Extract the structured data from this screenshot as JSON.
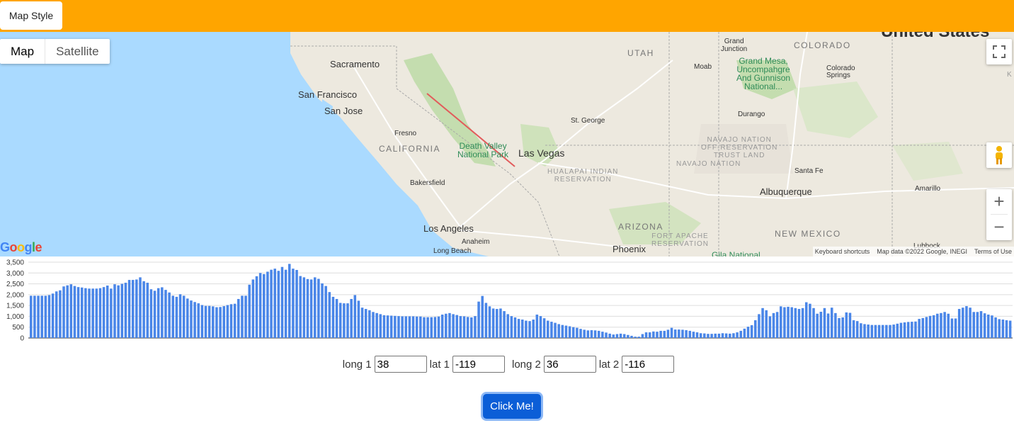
{
  "topbar": {
    "style_button": "Map Style",
    "color": "#FFA500"
  },
  "map": {
    "type_map": "Map",
    "type_satellite": "Satellite",
    "fullscreen_icon": "fullscreen-icon",
    "pegman_icon": "pegman-icon",
    "zoom_in": "+",
    "zoom_out": "−",
    "google_logo": "Google",
    "attribution": {
      "shortcuts": "Keyboard shortcuts",
      "data": "Map data ©2022 Google, INEGI",
      "terms": "Terms of Use"
    },
    "labels": {
      "sacramento": "Sacramento",
      "san_francisco": "San Francisco",
      "san_jose": "San Jose",
      "fresno": "Fresno",
      "california": "CALIFORNIA",
      "bakersfield": "Bakersfield",
      "los_angeles": "Los Angeles",
      "anaheim": "Anaheim",
      "long_beach": "Long Beach",
      "death_valley_1": "Death Valley",
      "death_valley_2": "National Park",
      "las_vegas": "Las Vegas",
      "st_george": "St. George",
      "hualapai_1": "HUALAPAI INDIAN",
      "hualapai_2": "RESERVATION",
      "utah": "UTAH",
      "grand_junction_1": "Grand",
      "grand_junction_2": "Junction",
      "colorado": "COLORADO",
      "moab": "Moab",
      "grand_mesa_1": "Grand Mesa,",
      "grand_mesa_2": "Uncompahgre",
      "grand_mesa_3": "And Gunnison",
      "grand_mesa_4": "National...",
      "colorado_springs_1": "Colorado",
      "colorado_springs_2": "Springs",
      "durango": "Durango",
      "navajo_1": "NAVAJO NATION",
      "navajo_2": "OFF-RESERVATION",
      "navajo_3": "TRUST LAND",
      "navajo_4": "NAVAJO NATION",
      "santa_fe": "Santa Fe",
      "albuquerque": "Albuquerque",
      "amarillo": "Amarillo",
      "united_states": "United States",
      "arizona": "ARIZONA",
      "fort_apache_1": "FORT APACHE",
      "fort_apache_2": "RESERVATION",
      "new_mexico": "NEW MEXICO",
      "phoenix": "Phoenix",
      "gila": "Gila National",
      "lubbock": "Lubbock",
      "k": "K"
    }
  },
  "chart_data": {
    "type": "bar",
    "yticks": [
      "3,500",
      "3,000",
      "2,500",
      "2,000",
      "1,500",
      "1,000",
      "500",
      "0"
    ],
    "ylim": [
      0,
      3500
    ],
    "grid": true,
    "color": "#4a86e8",
    "values": [
      1950,
      1950,
      1950,
      1950,
      1950,
      1980,
      2050,
      2150,
      2200,
      2380,
      2430,
      2480,
      2400,
      2350,
      2330,
      2300,
      2280,
      2280,
      2280,
      2300,
      2350,
      2420,
      2280,
      2480,
      2430,
      2500,
      2550,
      2680,
      2680,
      2700,
      2800,
      2620,
      2550,
      2250,
      2180,
      2300,
      2340,
      2220,
      2100,
      1950,
      1900,
      2020,
      1950,
      1820,
      1730,
      1660,
      1600,
      1520,
      1480,
      1480,
      1460,
      1420,
      1430,
      1470,
      1520,
      1560,
      1580,
      1800,
      1950,
      1950,
      2460,
      2700,
      2850,
      3000,
      2950,
      3060,
      3150,
      3200,
      3100,
      3280,
      3150,
      3420,
      3200,
      3140,
      2860,
      2800,
      2720,
      2700,
      2800,
      2730,
      2520,
      2400,
      2120,
      1900,
      1800,
      1620,
      1600,
      1600,
      1800,
      1980,
      1720,
      1400,
      1340,
      1280,
      1200,
      1150,
      1100,
      1050,
      1040,
      1030,
      1020,
      1010,
      1000,
      1000,
      1000,
      1000,
      990,
      990,
      960,
      960,
      960,
      970,
      990,
      1080,
      1120,
      1150,
      1100,
      1060,
      1010,
      1000,
      970,
      950,
      1010,
      1680,
      1940,
      1620,
      1460,
      1360,
      1340,
      1360,
      1240,
      1100,
      1010,
      950,
      880,
      850,
      800,
      780,
      850,
      1080,
      1010,
      910,
      800,
      750,
      700,
      640,
      600,
      570,
      540,
      500,
      470,
      420,
      380,
      350,
      360,
      350,
      330,
      290,
      250,
      200,
      160,
      180,
      200,
      180,
      140,
      100,
      60,
      60,
      180,
      260,
      260,
      300,
      290,
      330,
      330,
      380,
      470,
      390,
      390,
      380,
      360,
      330,
      290,
      260,
      220,
      210,
      190,
      190,
      200,
      200,
      220,
      210,
      200,
      220,
      260,
      330,
      430,
      520,
      590,
      820,
      1100,
      1380,
      1280,
      1000,
      1150,
      1200,
      1460,
      1420,
      1440,
      1420,
      1380,
      1340,
      1380,
      1650,
      1580,
      1380,
      1120,
      1210,
      1380,
      1130,
      1400,
      1150,
      920,
      950,
      1180,
      1160,
      820,
      780,
      680,
      640,
      620,
      600,
      600,
      600,
      600,
      600,
      600,
      620,
      660,
      700,
      720,
      740,
      750,
      760,
      880,
      920,
      970,
      1020,
      1050,
      1120,
      1150,
      1200,
      1120,
      900,
      900,
      1340,
      1400,
      1470,
      1400,
      1200,
      1200,
      1240,
      1140,
      1080,
      1040,
      950,
      870,
      850,
      820,
      800
    ]
  },
  "form": {
    "long1_label": "long 1",
    "long1_value": "38",
    "lat1_label": "lat 1",
    "lat1_value": "-119",
    "long2_label": "long 2",
    "long2_value": "36",
    "lat2_label": "lat 2",
    "lat2_value": "-116",
    "submit": "Click Me!"
  }
}
